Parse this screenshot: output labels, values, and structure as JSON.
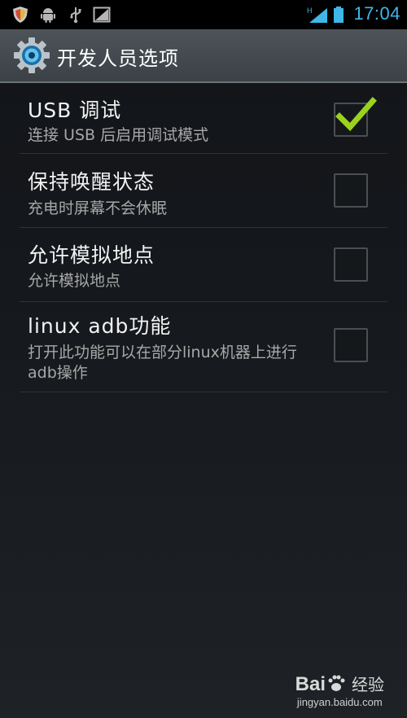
{
  "status_bar": {
    "time": "17:04",
    "icons": [
      "shield-icon",
      "android-icon",
      "usb-icon",
      "image-icon",
      "network-h-icon",
      "signal-icon",
      "battery-icon"
    ],
    "network_type": "H",
    "accent_color": "#3fb7e8"
  },
  "action_bar": {
    "title": "开发人员选项",
    "icon": "settings-gear-icon"
  },
  "preferences": [
    {
      "title": "USB 调试",
      "summary": "连接 USB 后启用调试模式",
      "checked": true
    },
    {
      "title": "保持唤醒状态",
      "summary": "充电时屏幕不会休眠",
      "checked": false
    },
    {
      "title": "允许模拟地点",
      "summary": "允许模拟地点",
      "checked": false
    },
    {
      "title": "linux adb功能",
      "summary": "打开此功能可以在部分linux机器上进行adb操作",
      "checked": false
    }
  ],
  "colors": {
    "check_green": "#9ad21e",
    "action_bar": "#454c51"
  },
  "watermark": {
    "logo_text": "Bai",
    "logo_suffix": "du",
    "logo_cn": "经验",
    "url": "jingyan.baidu.com"
  }
}
